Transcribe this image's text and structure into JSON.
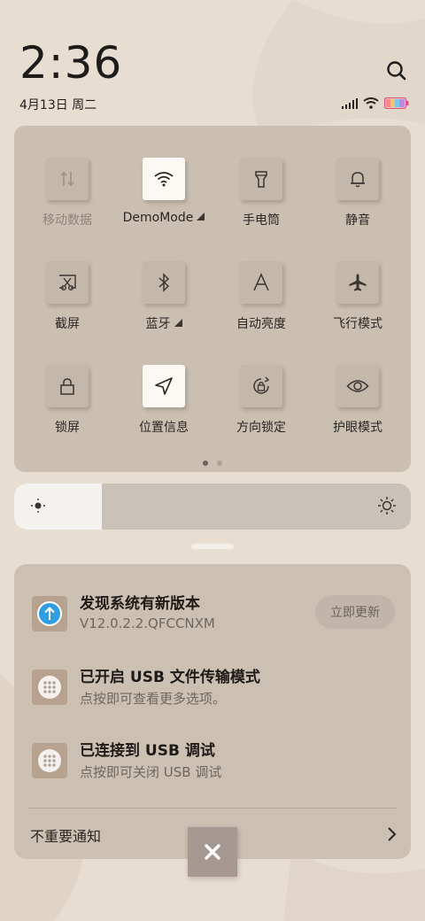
{
  "clock": {
    "time": "2:36",
    "date": "4月13日 周二"
  },
  "quick_settings": {
    "tiles": [
      {
        "label": "移动数据",
        "icon": "mobile-data-icon",
        "active": false,
        "disabled": true
      },
      {
        "label": "DemoMode",
        "icon": "wifi-icon",
        "active": true,
        "expandable": true
      },
      {
        "label": "手电筒",
        "icon": "flashlight-icon",
        "active": false
      },
      {
        "label": "静音",
        "icon": "bell-icon",
        "active": false
      },
      {
        "label": "截屏",
        "icon": "screenshot-icon",
        "active": false
      },
      {
        "label": "蓝牙",
        "icon": "bluetooth-icon",
        "active": false,
        "expandable": true
      },
      {
        "label": "自动亮度",
        "icon": "auto-brightness-icon",
        "active": false
      },
      {
        "label": "飞行模式",
        "icon": "airplane-icon",
        "active": false
      },
      {
        "label": "锁屏",
        "icon": "lock-icon",
        "active": false
      },
      {
        "label": "位置信息",
        "icon": "location-icon",
        "active": true
      },
      {
        "label": "方向锁定",
        "icon": "rotation-lock-icon",
        "active": false
      },
      {
        "label": "护眼模式",
        "icon": "eye-icon",
        "active": false
      }
    ],
    "page_indicator": {
      "pages": 2,
      "current": 1
    }
  },
  "brightness": {
    "level": 0.22
  },
  "notifications": [
    {
      "title": "发现系统有新版本",
      "text": "V12.0.2.2.QFCCNXM",
      "action": "立即更新",
      "icon": "update-arrow-icon"
    },
    {
      "title": "已开启 USB 文件传输模式",
      "text": "点按即可查看更多选项。",
      "icon": "dots-grid-icon"
    },
    {
      "title": "已连接到 USB 调试",
      "text": "点按即可关闭 USB 调试",
      "icon": "dots-grid-icon"
    }
  ],
  "unimportant": {
    "label": "不重要通知"
  },
  "colors": {
    "panel": "#cbbfb1",
    "accent_blue": "#2f9de0",
    "tile_on": "#fbf8f4"
  }
}
